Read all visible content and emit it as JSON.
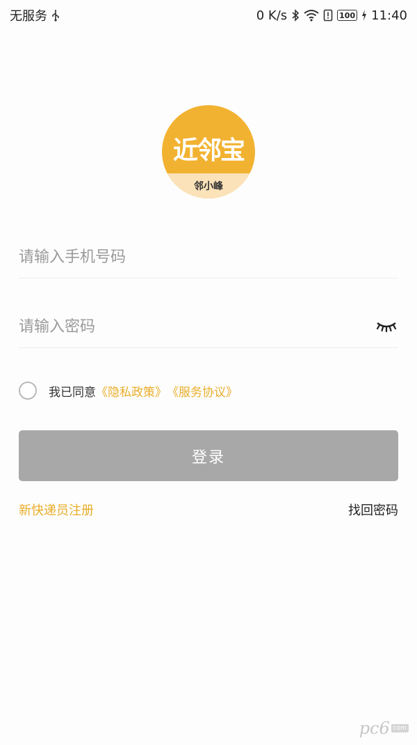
{
  "status_bar": {
    "carrier": "无服务",
    "net_speed": "0 K/s",
    "battery": "100",
    "time": "11:40"
  },
  "logo": {
    "mark_text": "近邻宝",
    "name": "邻小峰"
  },
  "phone_field": {
    "placeholder": "请输入手机号码"
  },
  "password_field": {
    "placeholder": "请输入密码"
  },
  "agreement": {
    "prefix": "我已同意",
    "privacy_link": "《隐私政策》",
    "service_link": "《服务协议》",
    "checked": false
  },
  "login_button": {
    "label": "登录"
  },
  "register_link": "新快递员注册",
  "forgot_link": "找回密码",
  "watermark": {
    "text": "pc6",
    "badge": "com"
  },
  "colors": {
    "accent": "#e9ad2a",
    "logo_bg": "#f2b231",
    "button_disabled": "#a8a8a8"
  }
}
